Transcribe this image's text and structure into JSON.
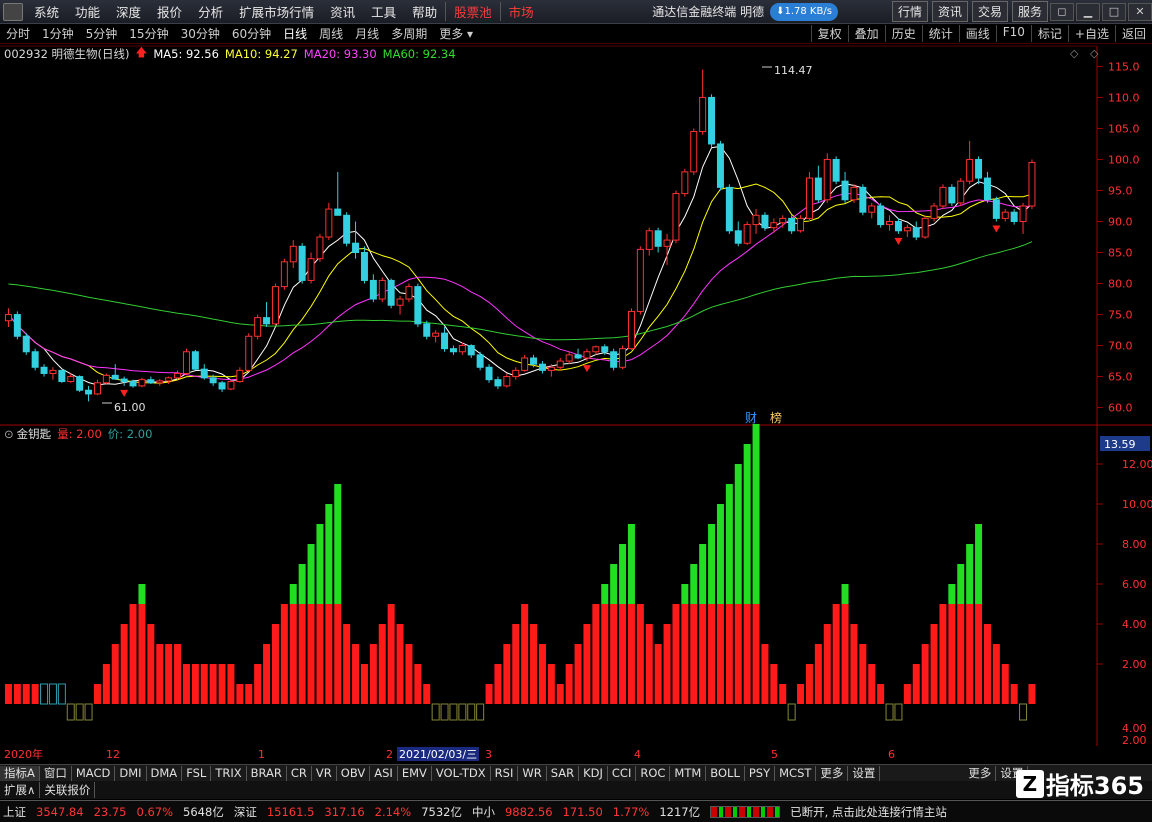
{
  "menu": {
    "items": [
      "系统",
      "功能",
      "深度",
      "报价",
      "分析",
      "扩展市场行情",
      "资讯",
      "工具",
      "帮助"
    ],
    "hot_items": [
      "股票池",
      "市场"
    ],
    "app_title": "通达信金融终端 明德",
    "speed": "1.78 KB/s",
    "right_buttons": [
      "行情",
      "资讯",
      "交易",
      "服务"
    ]
  },
  "periods": {
    "items": [
      "分时",
      "1分钟",
      "5分钟",
      "15分钟",
      "30分钟",
      "60分钟",
      "日线",
      "周线",
      "月线",
      "多周期",
      "更多"
    ],
    "active": "日线",
    "tools": [
      "复权",
      "叠加",
      "历史",
      "统计",
      "画线",
      "F10",
      "标记",
      "+自选",
      "返回"
    ]
  },
  "info": {
    "title": "002932 明德生物(日线)",
    "ma5": "MA5: 92.56",
    "ma10": "MA10: 94.27",
    "ma20": "MA20: 93.30",
    "ma60": "MA60: 92.34"
  },
  "price_axis": [
    "115.0",
    "110.0",
    "105.0",
    "100.0",
    "95.0",
    "90.0",
    "85.0",
    "80.0",
    "75.0",
    "70.0",
    "65.0",
    "60.0"
  ],
  "annotations": {
    "high": "114.47",
    "low": "61.00",
    "cai": "财",
    "bang": "榜"
  },
  "indicator": {
    "name": "金钥匙",
    "vol": "量: 2.00",
    "price": "价: 2.00",
    "current": "13.59",
    "axis": [
      "12.00",
      "10.00",
      "8.00",
      "6.00",
      "4.00",
      "2.00",
      "4.00",
      "2.00"
    ]
  },
  "xaxis": {
    "labels": [
      "2020年",
      "12",
      "1",
      "2",
      "2021/02/03/三",
      "3",
      "4",
      "5",
      "6"
    ]
  },
  "tabs": [
    "指标A",
    "窗口",
    "MACD",
    "DMI",
    "DMA",
    "FSL",
    "TRIX",
    "BRAR",
    "CR",
    "VR",
    "OBV",
    "ASI",
    "EMV",
    "VOL-TDX",
    "RSI",
    "WR",
    "SAR",
    "KDJ",
    "CCI",
    "ROC",
    "MTM",
    "BOLL",
    "PSY",
    "MCST",
    "更多",
    "设置"
  ],
  "tabs_right": [
    "更多",
    "设置"
  ],
  "ext": [
    "扩展∧",
    "关联报价"
  ],
  "status": {
    "sh_name": "上证",
    "sh_val": "3547.84",
    "sh_chg": "23.75",
    "sh_pct": "0.67%",
    "sh_amt": "5648亿",
    "sz_name": "深证",
    "sz_val": "15161.5",
    "sz_chg": "317.16",
    "sz_pct": "2.14%",
    "sz_amt": "7532亿",
    "zx_name": "中小",
    "zx_val": "9882.56",
    "zx_chg": "171.50",
    "zx_pct": "1.77%",
    "zx_amt": "1217亿",
    "message": "已断开, 点击此处连接行情主站"
  },
  "watermark": {
    "text": "指标365",
    "icon": "Z"
  },
  "chart_data": {
    "type": "candlestick",
    "ylim": [
      58,
      117
    ],
    "candles": [
      [
        74,
        76,
        73,
        75
      ],
      [
        75,
        75.5,
        71,
        71.5
      ],
      [
        71.5,
        72,
        68.5,
        69
      ],
      [
        69,
        69.5,
        66,
        66.5
      ],
      [
        66.5,
        67,
        65,
        65.5
      ],
      [
        65.5,
        66.5,
        64.5,
        66
      ],
      [
        66,
        66,
        64,
        64.2
      ],
      [
        64.2,
        65.5,
        64,
        65
      ],
      [
        65,
        65.2,
        62.5,
        62.8
      ],
      [
        62.8,
        63.5,
        61,
        62.2
      ],
      [
        62.2,
        64.5,
        62,
        64
      ],
      [
        64,
        65.5,
        63.8,
        65.2
      ],
      [
        65.2,
        67,
        64.5,
        64.6
      ],
      [
        64.6,
        65,
        63.5,
        64.2
      ],
      [
        64.2,
        64.5,
        63.2,
        63.5
      ],
      [
        63.5,
        64.8,
        63.3,
        64.5
      ],
      [
        64.5,
        65,
        63.8,
        64
      ],
      [
        64,
        64.6,
        63.5,
        64.3
      ],
      [
        64.3,
        65,
        63.8,
        64.8
      ],
      [
        64.8,
        66,
        64.5,
        65.5
      ],
      [
        65.5,
        69.5,
        65.3,
        69
      ],
      [
        69,
        69.3,
        66,
        66.2
      ],
      [
        66.2,
        67,
        64.5,
        64.8
      ],
      [
        64.8,
        65.3,
        63.5,
        64
      ],
      [
        64,
        64.3,
        62.5,
        63
      ],
      [
        63,
        64.5,
        62.8,
        64.2
      ],
      [
        64.2,
        66.5,
        64,
        66
      ],
      [
        66,
        72,
        65.8,
        71.5
      ],
      [
        71.5,
        75,
        71,
        74.5
      ],
      [
        74.5,
        77,
        73,
        73.5
      ],
      [
        73.5,
        80,
        73.2,
        79.5
      ],
      [
        79.5,
        84,
        79,
        83.5
      ],
      [
        83.5,
        87,
        82.5,
        86
      ],
      [
        86,
        86.5,
        80,
        80.5
      ],
      [
        80.5,
        85,
        80,
        84
      ],
      [
        84,
        88,
        83.5,
        87.5
      ],
      [
        87.5,
        93,
        87,
        92
      ],
      [
        92,
        98,
        91.5,
        91
      ],
      [
        91,
        91.5,
        86,
        86.5
      ],
      [
        86.5,
        90,
        84,
        85
      ],
      [
        85,
        86,
        80,
        80.5
      ],
      [
        80.5,
        81.5,
        77,
        77.5
      ],
      [
        77.5,
        81,
        77,
        80.5
      ],
      [
        80.5,
        80.8,
        76,
        76.5
      ],
      [
        76.5,
        78,
        75,
        77.5
      ],
      [
        77.5,
        80,
        77,
        79.5
      ],
      [
        79.5,
        80,
        73,
        73.5
      ],
      [
        73.5,
        74,
        71,
        71.5
      ],
      [
        71.5,
        72.5,
        70.5,
        72
      ],
      [
        72,
        73,
        69,
        69.5
      ],
      [
        69.5,
        70,
        68.5,
        69
      ],
      [
        69,
        70.5,
        68.5,
        70
      ],
      [
        70,
        70.2,
        68,
        68.5
      ],
      [
        68.5,
        69,
        66,
        66.5
      ],
      [
        66.5,
        67,
        64,
        64.5
      ],
      [
        64.5,
        65,
        63,
        63.5
      ],
      [
        63.5,
        65.5,
        63.2,
        65
      ],
      [
        65,
        66.5,
        64.5,
        66
      ],
      [
        66,
        68.5,
        65.8,
        68
      ],
      [
        68,
        68.5,
        66.5,
        67
      ],
      [
        67,
        67.5,
        65.5,
        66
      ],
      [
        66,
        67,
        65,
        66.5
      ],
      [
        66.5,
        68,
        66,
        67.5
      ],
      [
        67.5,
        69,
        67,
        68.5
      ],
      [
        68.5,
        69.5,
        67.8,
        68
      ],
      [
        68,
        69.5,
        67.5,
        69
      ],
      [
        69,
        70,
        68.5,
        69.8
      ],
      [
        69.8,
        70.2,
        68.5,
        69
      ],
      [
        69,
        69.5,
        66,
        66.5
      ],
      [
        66.5,
        70,
        66.2,
        69.5
      ],
      [
        69.5,
        76,
        69.3,
        75.5
      ],
      [
        75.5,
        86,
        75,
        85.5
      ],
      [
        85.5,
        89,
        84.5,
        88.5
      ],
      [
        88.5,
        89,
        85,
        86
      ],
      [
        86,
        88,
        83,
        87
      ],
      [
        87,
        95,
        86.5,
        94.5
      ],
      [
        94.5,
        98.5,
        94,
        98
      ],
      [
        98,
        105,
        97.5,
        104.5
      ],
      [
        104.5,
        114.5,
        104,
        110
      ],
      [
        110,
        110.5,
        102,
        102.5
      ],
      [
        102.5,
        103,
        95,
        95.5
      ],
      [
        95.5,
        96,
        88,
        88.5
      ],
      [
        88.5,
        90,
        86,
        86.5
      ],
      [
        86.5,
        90,
        86.2,
        89.5
      ],
      [
        89.5,
        92,
        88,
        91
      ],
      [
        91,
        91.5,
        88.5,
        89
      ],
      [
        89,
        90.5,
        88.2,
        89.8
      ],
      [
        89.8,
        91,
        89,
        90.5
      ],
      [
        90.5,
        91,
        88,
        88.5
      ],
      [
        88.5,
        91,
        88.2,
        90.5
      ],
      [
        90.5,
        98,
        90,
        97
      ],
      [
        97,
        99,
        93,
        93.5
      ],
      [
        93.5,
        101,
        93,
        100
      ],
      [
        100,
        100.5,
        96,
        96.5
      ],
      [
        96.5,
        98,
        93,
        93.5
      ],
      [
        93.5,
        96,
        93,
        95.5
      ],
      [
        95.5,
        96,
        91,
        91.5
      ],
      [
        91.5,
        93,
        90.5,
        92.5
      ],
      [
        92.5,
        93,
        89,
        89.5
      ],
      [
        89.5,
        91,
        88.5,
        90
      ],
      [
        90,
        90.5,
        88,
        88.5
      ],
      [
        88.5,
        89.5,
        87.5,
        89
      ],
      [
        89,
        90,
        87,
        87.5
      ],
      [
        87.5,
        91,
        87.2,
        90.5
      ],
      [
        90.5,
        93,
        90,
        92.5
      ],
      [
        92.5,
        96,
        92,
        95.5
      ],
      [
        95.5,
        96,
        92.5,
        93
      ],
      [
        93,
        97,
        92.5,
        96.5
      ],
      [
        96.5,
        103,
        96,
        100
      ],
      [
        100,
        100.5,
        96,
        97
      ],
      [
        97,
        98,
        93,
        93.5
      ],
      [
        93.5,
        94,
        90,
        90.5
      ],
      [
        90.5,
        92,
        90,
        91.5
      ],
      [
        91.5,
        92,
        89.5,
        90
      ],
      [
        90,
        93,
        88,
        92.5
      ],
      [
        92.5,
        100,
        92,
        99.5
      ]
    ],
    "ma": [
      {
        "name": "MA5",
        "color": "#ffffff",
        "period": 5
      },
      {
        "name": "MA10",
        "color": "#ffff00",
        "period": 10
      },
      {
        "name": "MA20",
        "color": "#ff33ff",
        "period": 20
      },
      {
        "name": "MA60",
        "color": "#33cc33",
        "period": 60,
        "seed": 80
      }
    ],
    "indicator_bars": [
      [
        1,
        1,
        0
      ],
      [
        1,
        1,
        0
      ],
      [
        1,
        1,
        0
      ],
      [
        1,
        1,
        0
      ],
      [
        1,
        0,
        0
      ],
      [
        1,
        0,
        0
      ],
      [
        1,
        0,
        0
      ],
      [
        0,
        0,
        0
      ],
      [
        0,
        0,
        0
      ],
      [
        0,
        0,
        0
      ],
      [
        1,
        1,
        0
      ],
      [
        2,
        2,
        0
      ],
      [
        3,
        3,
        0
      ],
      [
        4,
        4,
        0
      ],
      [
        5,
        5,
        0
      ],
      [
        6,
        5,
        1
      ],
      [
        4,
        4,
        0
      ],
      [
        3,
        3,
        0
      ],
      [
        3,
        3,
        0
      ],
      [
        3,
        3,
        0
      ],
      [
        2,
        2,
        0
      ],
      [
        2,
        2,
        0
      ],
      [
        2,
        2,
        0
      ],
      [
        2,
        2,
        0
      ],
      [
        2,
        2,
        0
      ],
      [
        2,
        2,
        0
      ],
      [
        1,
        1,
        0
      ],
      [
        1,
        1,
        0
      ],
      [
        2,
        2,
        0
      ],
      [
        3,
        3,
        0
      ],
      [
        4,
        4,
        0
      ],
      [
        5,
        5,
        0
      ],
      [
        6,
        5,
        1
      ],
      [
        7,
        5,
        2
      ],
      [
        8,
        5,
        3
      ],
      [
        9,
        5,
        4
      ],
      [
        10,
        5,
        5
      ],
      [
        11,
        5,
        6
      ],
      [
        4,
        4,
        0
      ],
      [
        3,
        3,
        0
      ],
      [
        2,
        2,
        0
      ],
      [
        3,
        3,
        0
      ],
      [
        4,
        4,
        0
      ],
      [
        5,
        5,
        0
      ],
      [
        4,
        4,
        0
      ],
      [
        3,
        3,
        0
      ],
      [
        2,
        2,
        0
      ],
      [
        1,
        1,
        0
      ],
      [
        0,
        0,
        0
      ],
      [
        0,
        0,
        0
      ],
      [
        0,
        0,
        0
      ],
      [
        0,
        0,
        0
      ],
      [
        0,
        0,
        0
      ],
      [
        0,
        0,
        0
      ],
      [
        1,
        1,
        0
      ],
      [
        2,
        2,
        0
      ],
      [
        3,
        3,
        0
      ],
      [
        4,
        4,
        0
      ],
      [
        5,
        5,
        0
      ],
      [
        4,
        4,
        0
      ],
      [
        3,
        3,
        0
      ],
      [
        2,
        2,
        0
      ],
      [
        1,
        1,
        0
      ],
      [
        2,
        2,
        0
      ],
      [
        3,
        3,
        0
      ],
      [
        4,
        4,
        0
      ],
      [
        5,
        5,
        0
      ],
      [
        6,
        5,
        1
      ],
      [
        7,
        5,
        2
      ],
      [
        8,
        5,
        3
      ],
      [
        9,
        5,
        4
      ],
      [
        5,
        5,
        0
      ],
      [
        4,
        4,
        0
      ],
      [
        3,
        3,
        0
      ],
      [
        4,
        4,
        0
      ],
      [
        5,
        5,
        0
      ],
      [
        6,
        5,
        1
      ],
      [
        7,
        5,
        2
      ],
      [
        8,
        5,
        3
      ],
      [
        9,
        5,
        4
      ],
      [
        10,
        5,
        5
      ],
      [
        11,
        5,
        6
      ],
      [
        12,
        5,
        7
      ],
      [
        13,
        5,
        8
      ],
      [
        14,
        5,
        9
      ],
      [
        3,
        3,
        0
      ],
      [
        2,
        2,
        0
      ],
      [
        1,
        1,
        0
      ],
      [
        0,
        0,
        0
      ],
      [
        1,
        1,
        0
      ],
      [
        2,
        2,
        0
      ],
      [
        3,
        3,
        0
      ],
      [
        4,
        4,
        0
      ],
      [
        5,
        5,
        0
      ],
      [
        6,
        5,
        1
      ],
      [
        4,
        4,
        0
      ],
      [
        3,
        3,
        0
      ],
      [
        2,
        2,
        0
      ],
      [
        1,
        1,
        0
      ],
      [
        0,
        0,
        0
      ],
      [
        0,
        0,
        0
      ],
      [
        1,
        1,
        0
      ],
      [
        2,
        2,
        0
      ],
      [
        3,
        3,
        0
      ],
      [
        4,
        4,
        0
      ],
      [
        5,
        5,
        0
      ],
      [
        6,
        5,
        1
      ],
      [
        7,
        5,
        2
      ],
      [
        8,
        5,
        3
      ],
      [
        9,
        5,
        4
      ],
      [
        4,
        4,
        0
      ],
      [
        3,
        3,
        0
      ],
      [
        2,
        2,
        0
      ],
      [
        1,
        1,
        0
      ],
      [
        0,
        0,
        0
      ],
      [
        1,
        1,
        0
      ]
    ],
    "signals": [
      {
        "index": 13,
        "dir": "down",
        "color": "#ff2020"
      },
      {
        "index": 65,
        "dir": "down",
        "color": "#ff2020"
      },
      {
        "index": 100,
        "dir": "down",
        "color": "#ff2020"
      },
      {
        "index": 111,
        "dir": "down",
        "color": "#ff2020"
      }
    ]
  }
}
